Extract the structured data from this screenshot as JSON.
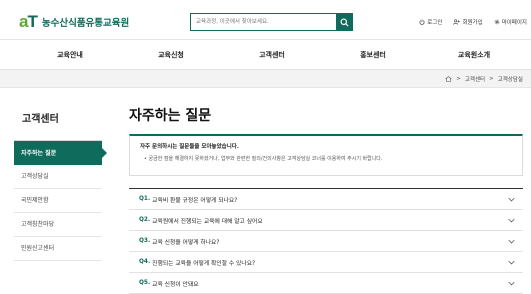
{
  "header": {
    "logo_mark": "aT",
    "logo_text": "농수산식품유통교육원",
    "search_placeholder": "교육과정, 이곳에서 찾아보세요.",
    "util": [
      {
        "label": "로그인",
        "icon": "power-icon"
      },
      {
        "label": "회원가입",
        "icon": "user-plus-icon"
      },
      {
        "label": "마이페이지",
        "icon": "gear-icon"
      }
    ]
  },
  "gnb": [
    "교육안내",
    "교육신청",
    "고객센터",
    "홍보센터",
    "교육원소개"
  ],
  "breadcrumb": [
    "고객센터",
    "고객상담실"
  ],
  "sidebar": {
    "title": "고객센터",
    "items": [
      "자주하는 질문",
      "고객상담실",
      "국민제안함",
      "고객칭찬마당",
      "민원신고센터"
    ]
  },
  "main": {
    "title": "자주하는 질문",
    "notice_head": "자주 문의하시는 질문들을 모아놓았습니다.",
    "notice_body": "궁금한 점을 해결하지 못하셨거나, 업무와 관련한 질의/건의사항은 고객상담실 코너를 이용하여 주시기 바랍니다."
  },
  "faq": [
    {
      "q": "Q1.",
      "text": "교육비 환불 규정은 어떻게 되나요?"
    },
    {
      "q": "Q2.",
      "text": "교육원에서 진행되는 교육에 대해 알고 싶어요"
    },
    {
      "q": "Q3.",
      "text": "교육 신청을 어떻게 하나요?"
    },
    {
      "q": "Q4.",
      "text": "진행되는 교육을 어떻게 확인할 수 있나요?"
    },
    {
      "q": "Q5.",
      "text": "교육 신청이 안돼요"
    }
  ],
  "colors": {
    "brand": "#0f6b5b",
    "accent": "#5ea632"
  }
}
